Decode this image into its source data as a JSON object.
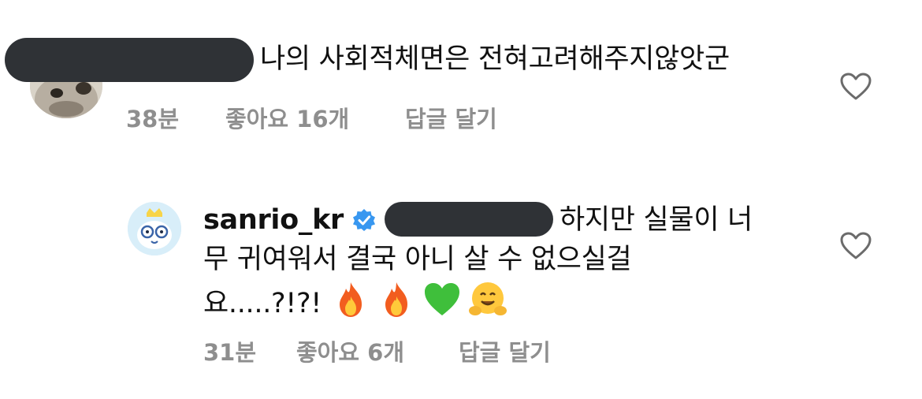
{
  "comments": [
    {
      "text": "나의 사회적체면은 전혀고려해주지않앗군",
      "time": "38분",
      "likes": "좋아요 16개",
      "reply": "답글 달기"
    },
    {
      "username": "sanrio_kr",
      "text_line1": "하지만 실물이 너",
      "text_line2": "무 귀여워서 결국 아니 살 수 없으실걸",
      "text_line3": "요.....?!?!",
      "emojis": [
        "fire-emoji",
        "fire-emoji",
        "green-heart-emoji",
        "hugging-face-emoji"
      ],
      "time": "31분",
      "likes": "좋아요 6개",
      "reply": "답글 달기"
    }
  ],
  "colors": {
    "redaction": "#2f3236",
    "meta_gray": "#8e8e8e",
    "verified_blue": "#3897f0"
  }
}
